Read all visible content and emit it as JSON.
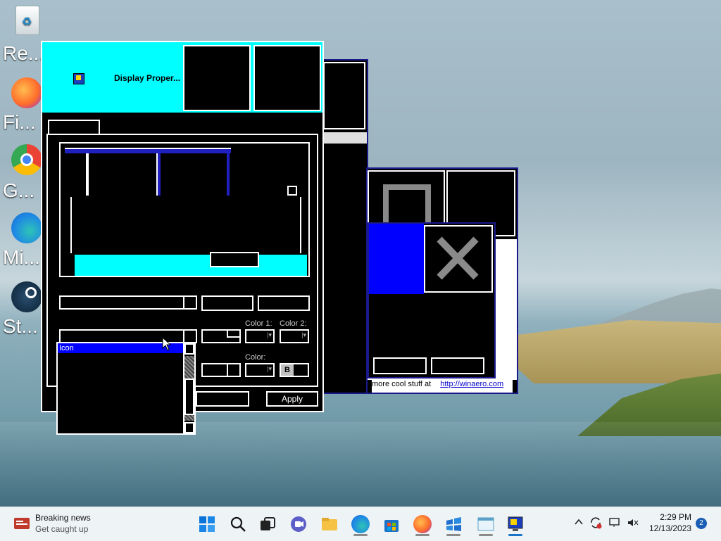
{
  "desktop": {
    "icons": [
      {
        "label": "Re...",
        "icon": "recycle-bin-icon"
      },
      {
        "label": "Fi...",
        "icon": "firefox-icon"
      },
      {
        "label": "G...",
        "icon": "chrome-icon"
      },
      {
        "label": "Mi...",
        "icon": "edge-icon"
      },
      {
        "label": "St...",
        "icon": "steam-icon"
      }
    ]
  },
  "display_properties": {
    "title": "Display Proper...",
    "labels": {
      "color1": "Color 1:",
      "color2": "Color 2:",
      "color": "Color:",
      "bold": "B"
    },
    "item_list": {
      "selected": "Icon"
    },
    "buttons": {
      "apply": "Apply"
    }
  },
  "winaero_window": {
    "footer_text": "more cool stuff at",
    "link": "http://winaero.com"
  },
  "taskbar": {
    "news_title": "Breaking news",
    "news_subtitle": "Get caught up",
    "time": "2:29 PM",
    "date": "12/13/2023",
    "notification_count": "2"
  },
  "colors": {
    "high_contrast_bg": "#000000",
    "high_contrast_fg": "#ffffff",
    "active_title": "#00ffff",
    "selection": "#0000ff",
    "border_blue": "#0000aa"
  }
}
